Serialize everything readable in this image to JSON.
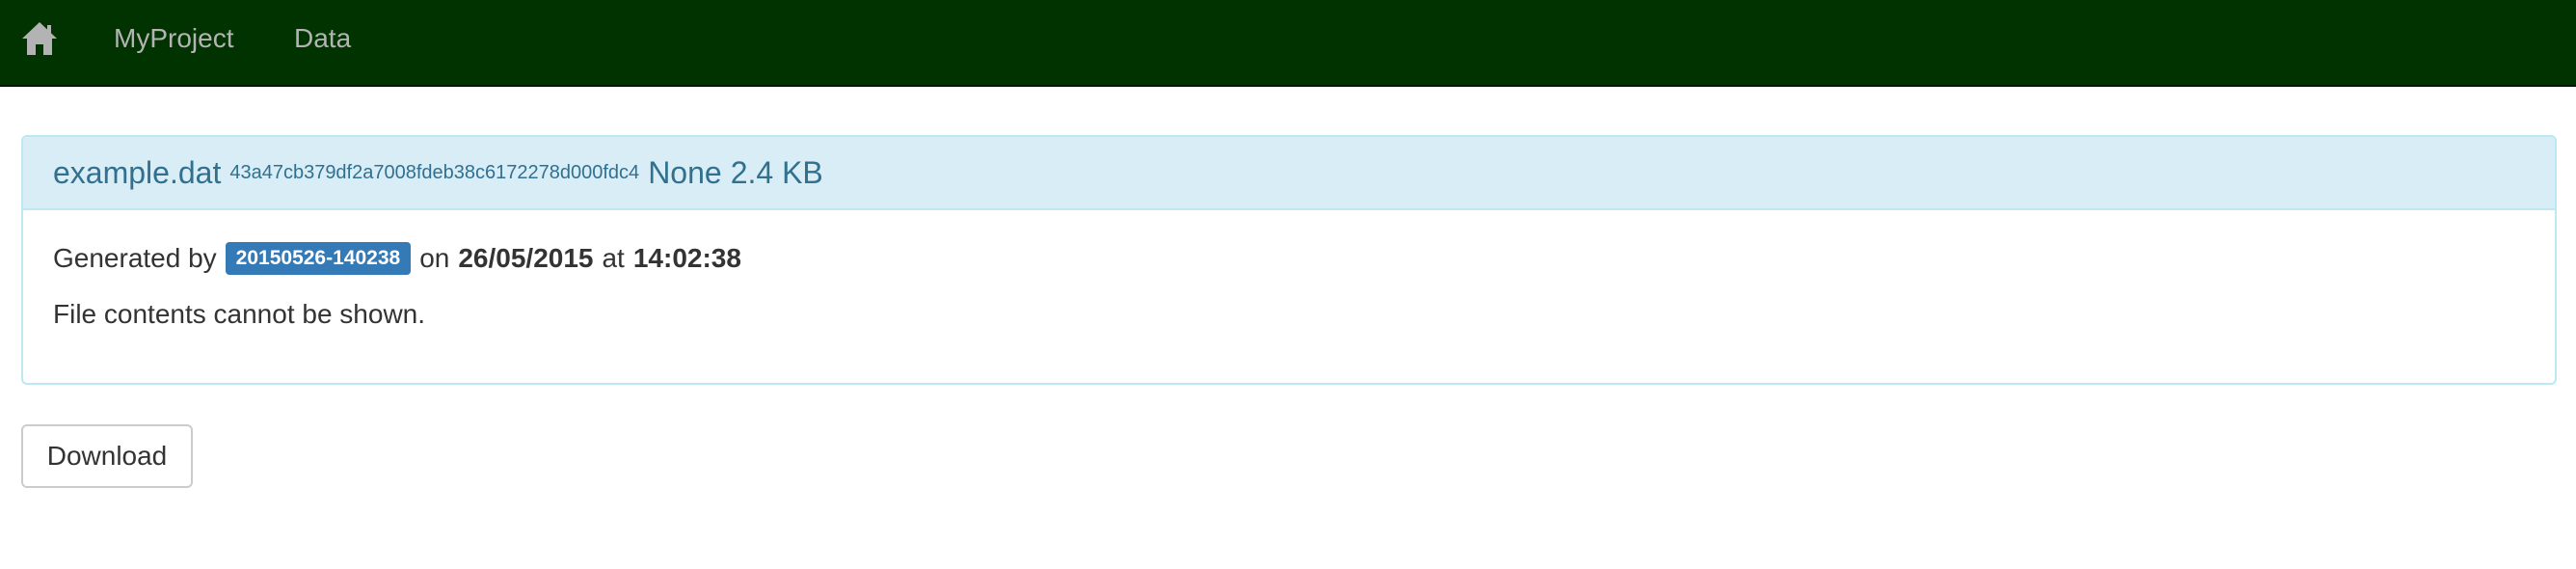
{
  "navbar": {
    "home_icon": "home-icon",
    "links": [
      "MyProject",
      "Data"
    ],
    "background": "#003300",
    "link_color": "#b3b3b3"
  },
  "file_panel": {
    "filename": "example.dat",
    "hash": "43a47cb379df2a7008fdeb38c6172278d000fdc4",
    "type": "None",
    "size": "2.4 KB",
    "generated_prefix": "Generated by",
    "run_label": "20150526-140238",
    "on_text": "on",
    "date": "26/05/2015",
    "at_text": "at",
    "time": "14:02:38",
    "contents_message": "File contents cannot be shown.",
    "heading_color": "#31708f",
    "heading_bg": "#d9edf7",
    "badge_color": "#337ab7"
  },
  "actions": {
    "download_label": "Download"
  }
}
